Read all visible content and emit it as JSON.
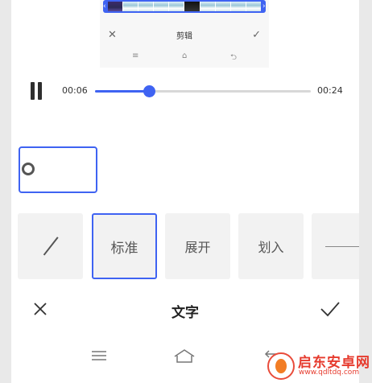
{
  "preview": {
    "title": "剪辑",
    "close_icon": "close-icon",
    "confirm_icon": "check-icon",
    "nav": [
      "≡",
      "⌂",
      "⮌"
    ]
  },
  "player": {
    "current_time": "00:06",
    "total_time": "00:24",
    "progress": 0.25
  },
  "styles": {
    "options": [
      "",
      "标准",
      "展开",
      "划入",
      ""
    ],
    "selected": "标准"
  },
  "editbar": {
    "title": "文字"
  },
  "colors": {
    "accent": "#3f63f2"
  },
  "watermark": {
    "name": "启东安卓网",
    "url": "www.qdltdq.com"
  }
}
